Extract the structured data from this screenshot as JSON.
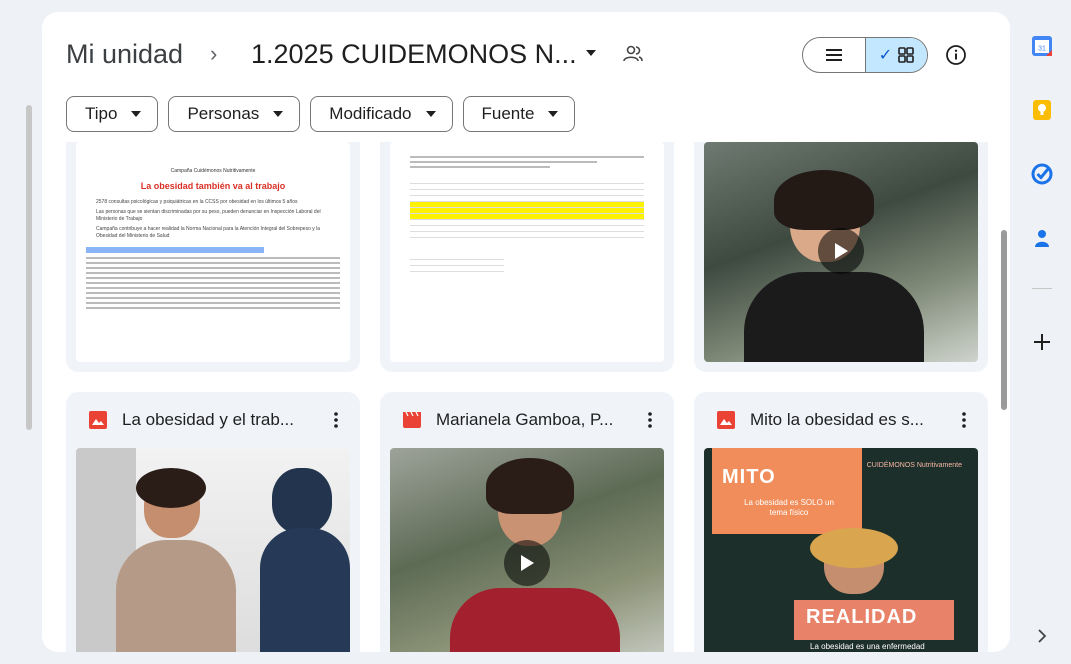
{
  "breadcrumb": {
    "root": "Mi unidad",
    "separator": "›",
    "current": "1.2025 CUIDEMONOS N..."
  },
  "filters": [
    "Tipo",
    "Personas",
    "Modificado",
    "Fuente"
  ],
  "view_toggle": {
    "active": "grid",
    "check_glyph": "✓"
  },
  "top_row": [
    {
      "kind": "document",
      "doc_heading": "Campaña Cuidémonos Nutritivamente",
      "doc_title": "La obesidad también va al trabajo",
      "bullets": [
        "2578 consultas psicológicas y psiquiátricas en la CCSS por obesidad en los últimos 5 años",
        "Las personas que se sientan discriminadas por su peso, pueden denunciar en Inspección Laboral del Ministerio de Trabajo",
        "Campaña contribuye a hacer realidad la Norma Nacional para la Atención Integral del Sobrepeso y la Obesidad del Ministerio de Salud"
      ]
    },
    {
      "kind": "sheet"
    },
    {
      "kind": "video"
    }
  ],
  "bottom_row": [
    {
      "title": "La obesidad y el trab...",
      "icon": "image-file-icon",
      "icon_color": "#ea4335",
      "kind": "photo"
    },
    {
      "title": "Marianela Gamboa, P...",
      "icon": "video-file-icon",
      "icon_color": "#ea4335",
      "kind": "video"
    },
    {
      "title": "Mito la obesidad es s...",
      "icon": "image-file-icon",
      "icon_color": "#ea4335",
      "kind": "mito",
      "mito_heading": "MITO",
      "mito_text": "La obesidad es SOLO un tema físico",
      "realidad_heading": "REALIDAD",
      "realidad_text": "La obesidad es una enfermedad",
      "brand": "CUIDÉMONOS Nutritivamente"
    }
  ],
  "side_panel": [
    "calendar-icon",
    "keep-icon",
    "tasks-icon",
    "contacts-icon",
    "add-icon",
    "expand-icon"
  ],
  "colors": {
    "accent": "#c2e7ff",
    "file_red": "#ea4335",
    "surface": "#f0f4f9"
  }
}
